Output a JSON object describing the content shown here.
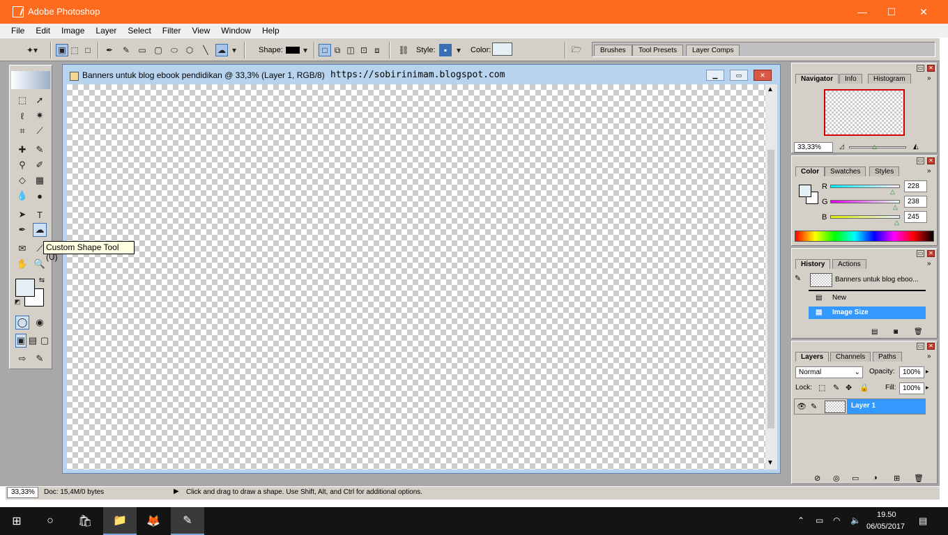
{
  "window": {
    "title": "Adobe Photoshop",
    "minimize_glyph": "—",
    "maximize_glyph": "☐",
    "close_glyph": "✕"
  },
  "menu": [
    "File",
    "Edit",
    "Image",
    "Layer",
    "Select",
    "Filter",
    "View",
    "Window",
    "Help"
  ],
  "options_bar": {
    "shape_label": "Shape:",
    "style_label": "Style:",
    "color_label": "Color:",
    "color_value": "#e4eef5",
    "well_tabs": [
      "Brushes",
      "Tool Presets",
      "Layer Comps"
    ]
  },
  "document": {
    "title": "Banners untuk blog ebook pendidikan @ 33,3% (Layer 1, RGB/8)",
    "watermark_url": "https://sobirinimam.blogspot.com"
  },
  "tooltip": "Custom Shape Tool (U)",
  "status": {
    "zoom": "33,33%",
    "doc_info": "Doc: 15,4M/0 bytes",
    "hint": "Click and drag to draw a shape.  Use Shift, Alt, and Ctrl for additional options."
  },
  "navigator": {
    "tabs": [
      "Navigator",
      "Info",
      "Histogram"
    ],
    "zoom": "33,33%"
  },
  "color_palette": {
    "tabs": [
      "Color",
      "Swatches",
      "Styles"
    ],
    "channels": [
      {
        "label": "R",
        "value": "228"
      },
      {
        "label": "G",
        "value": "238"
      },
      {
        "label": "B",
        "value": "245"
      }
    ]
  },
  "history": {
    "tabs": [
      "History",
      "Actions"
    ],
    "snapshot": "Banners untuk blog eboo...",
    "items": [
      "New",
      "Image Size"
    ]
  },
  "layers": {
    "tabs": [
      "Layers",
      "Channels",
      "Paths"
    ],
    "blend_mode": "Normal",
    "opacity_label": "Opacity:",
    "opacity": "100%",
    "lock_label": "Lock:",
    "fill_label": "Fill:",
    "fill": "100%",
    "layer_name": "Layer 1"
  },
  "taskbar": {
    "time": "19.50",
    "date": "06/05/2017"
  },
  "colors": {
    "title_bar": "#fe6a1e",
    "selection": "#3399ff",
    "foreground": "#e4eef5"
  }
}
